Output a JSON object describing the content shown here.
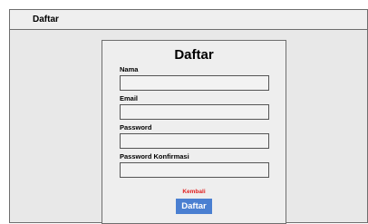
{
  "header": {
    "brand": "Daftar"
  },
  "form": {
    "title": "Daftar",
    "fields": [
      {
        "label": "Nama",
        "value": "",
        "placeholder": ""
      },
      {
        "label": "Email",
        "value": "",
        "placeholder": ""
      },
      {
        "label": "Password",
        "value": "",
        "placeholder": ""
      },
      {
        "label": "Password Konfirmasi",
        "value": "",
        "placeholder": ""
      }
    ],
    "back_link": "Kembali",
    "submit_label": "Daftar"
  },
  "colors": {
    "submit_bg": "#4a7fd1",
    "back_link": "#e02020"
  }
}
